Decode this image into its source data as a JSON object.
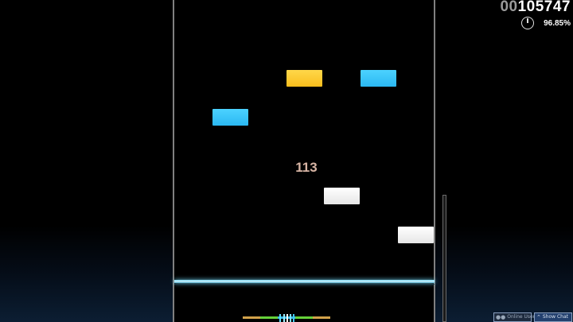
{
  "hud": {
    "score_leading_zeros": "00",
    "score_value": "105747",
    "accuracy": "96.85%",
    "accuracy_icon": "pie-timer-icon",
    "combo": "113"
  },
  "notes": [
    {
      "color": "yellow",
      "lane": 2
    },
    {
      "color": "blue",
      "lane": 3
    },
    {
      "color": "blue",
      "lane": 1
    },
    {
      "color": "white",
      "lane": 2
    },
    {
      "color": "white",
      "lane": 3
    }
  ],
  "colors": {
    "note_yellow": "#f9c927",
    "note_blue": "#3cc6fa",
    "note_white": "#f2f2f2",
    "judgement_line": "#8fdcf2",
    "combo_text": "#d7b4a4"
  },
  "chat": {
    "online_users_label": "Online Users",
    "show_chat_label": "Show Chat",
    "online_users_icon": "users-icon",
    "show_chat_icon": "chevron-up-icon"
  }
}
